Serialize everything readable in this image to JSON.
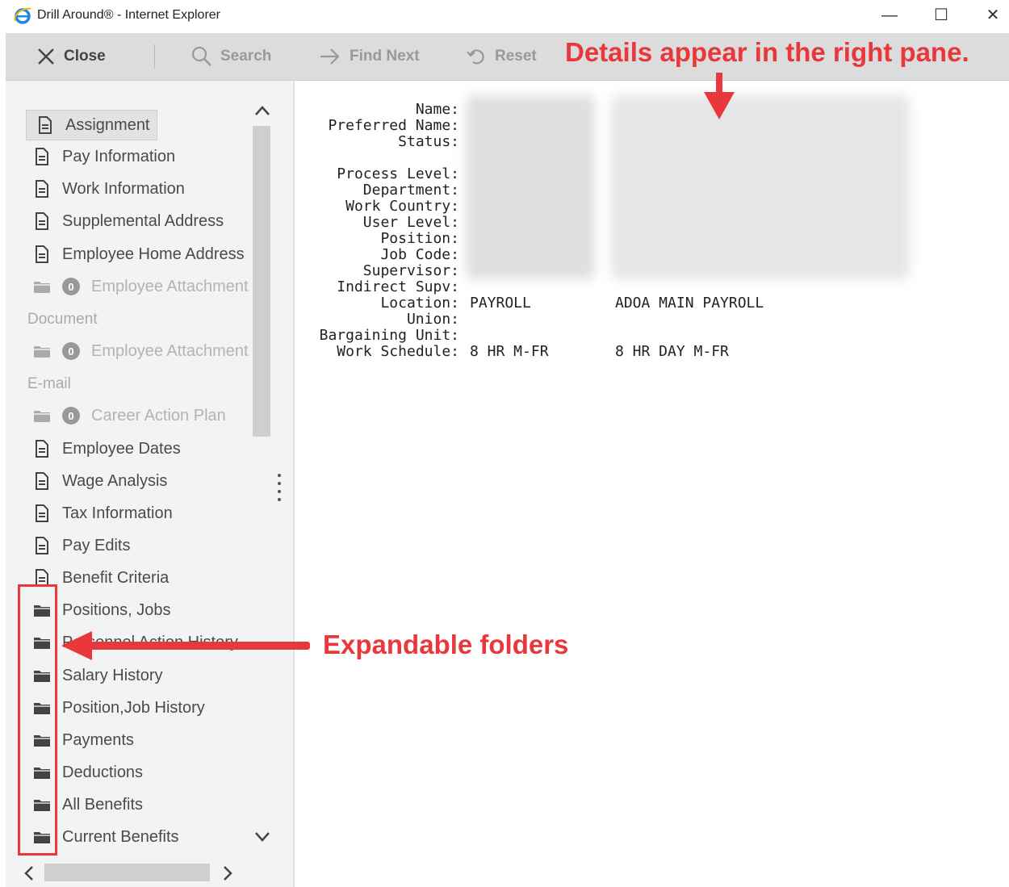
{
  "window": {
    "title": "Drill Around® - Internet Explorer",
    "controls": {
      "minimize": "—",
      "maximize": "☐",
      "close": "✕"
    }
  },
  "toolbar": {
    "close_label": "Close",
    "search_label": "Search",
    "find_next_label": "Find Next",
    "reset_label": "Reset"
  },
  "callouts": {
    "top": "Details appear in the right pane.",
    "bottom": "Expandable folders",
    "color": "#e8383b"
  },
  "sidebar": {
    "items": [
      {
        "label": "Assignment",
        "icon": "document-icon"
      },
      {
        "label": "Pay Information",
        "icon": "document-icon"
      },
      {
        "label": "Work Information",
        "icon": "document-icon"
      },
      {
        "label": "Supplemental Address",
        "icon": "document-icon"
      },
      {
        "label": "Employee Home Address",
        "icon": "document-icon"
      },
      {
        "label": "Employee Attachment",
        "icon": "folder-icon",
        "badge": "0"
      },
      {
        "label": "Document",
        "group": true
      },
      {
        "label": "Employee Attachment",
        "icon": "folder-icon",
        "badge": "0"
      },
      {
        "label": "E-mail",
        "group": true
      },
      {
        "label": "Career Action Plan",
        "icon": "folder-icon",
        "badge": "0"
      },
      {
        "label": "Employee Dates",
        "icon": "document-icon"
      },
      {
        "label": "Wage Analysis",
        "icon": "document-icon"
      },
      {
        "label": "Tax Information",
        "icon": "document-icon"
      },
      {
        "label": "Pay Edits",
        "icon": "document-icon"
      },
      {
        "label": "Benefit Criteria",
        "icon": "document-icon"
      },
      {
        "label": "Positions, Jobs",
        "icon": "folder-icon"
      },
      {
        "label": "Personnel Action History",
        "icon": "folder-icon"
      },
      {
        "label": "Salary History",
        "icon": "folder-icon"
      },
      {
        "label": "Position,Job History",
        "icon": "folder-icon"
      },
      {
        "label": "Payments",
        "icon": "folder-icon"
      },
      {
        "label": "Deductions",
        "icon": "folder-icon"
      },
      {
        "label": "All Benefits",
        "icon": "folder-icon"
      },
      {
        "label": "Current Benefits",
        "icon": "folder-icon"
      }
    ]
  },
  "details": {
    "labels": [
      "Name:",
      "Preferred Name:",
      "Status:",
      "",
      "Process Level:",
      "Department:",
      "Work Country:",
      "User Level:",
      "Position:",
      "Job Code:",
      "Supervisor:",
      "Indirect Supv:",
      "Location:",
      "Union:",
      "Bargaining Unit:",
      "Work Schedule:"
    ],
    "location_code": "PAYROLL",
    "location_desc": "ADOA MAIN PAYROLL",
    "schedule_code": "8 HR M-FR",
    "schedule_desc": "8 HR DAY M-FR"
  }
}
